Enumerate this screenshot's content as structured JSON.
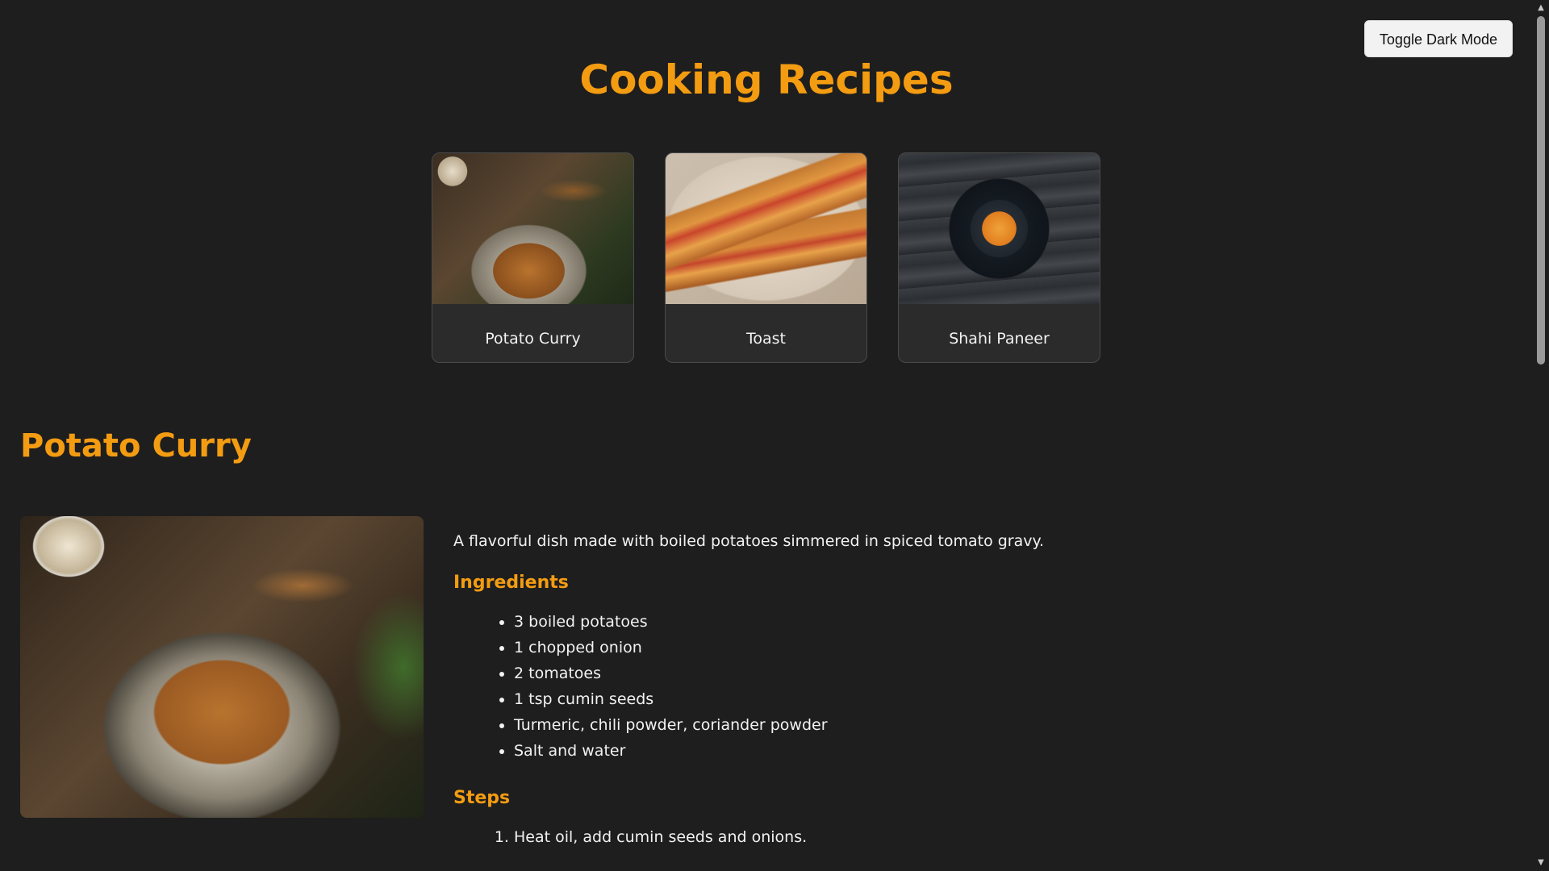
{
  "header": {
    "toggle_label": "Toggle Dark Mode",
    "title": "Cooking Recipes"
  },
  "cards": [
    {
      "name": "Potato Curry",
      "image_icon": "potato-curry-photo"
    },
    {
      "name": "Toast",
      "image_icon": "toast-photo"
    },
    {
      "name": "Shahi Paneer",
      "image_icon": "shahi-paneer-photo"
    }
  ],
  "detail": {
    "title": "Potato Curry",
    "description": "A flavorful dish made with boiled potatoes simmered in spiced tomato gravy.",
    "ingredients_heading": "Ingredients",
    "ingredients": [
      "3 boiled potatoes",
      "1 chopped onion",
      "2 tomatoes",
      "1 tsp cumin seeds",
      "Turmeric, chili powder, coriander powder",
      "Salt and water"
    ],
    "steps_heading": "Steps",
    "steps": [
      "Heat oil, add cumin seeds and onions."
    ]
  },
  "colors": {
    "background": "#1e1e1e",
    "accent": "#f39c12",
    "card_background": "#2b2b2b",
    "text": "#f2f2f2"
  }
}
